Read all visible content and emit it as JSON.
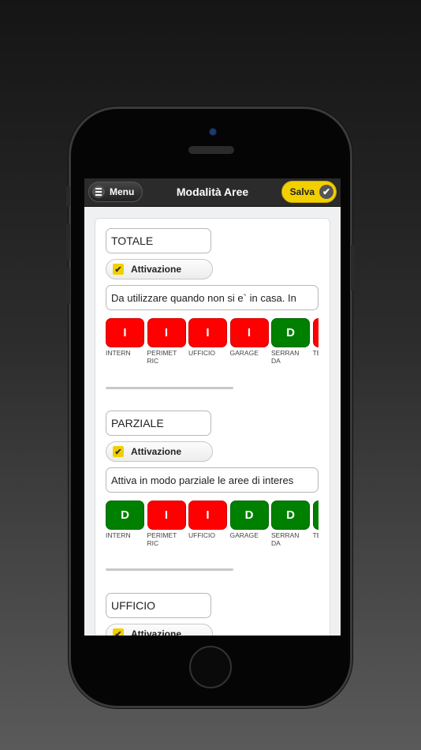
{
  "header": {
    "menu_label": "Menu",
    "title": "Modalità Aree",
    "save_label": "Salva"
  },
  "colors": {
    "on": "#ff0000",
    "off": "#008000",
    "accent": "#f2d000"
  },
  "modes": [
    {
      "name": "TOTALE",
      "activation_label": "Attivazione",
      "activation_checked": true,
      "description": "Da utilizzare quando non si e` in casa. In",
      "areas": [
        {
          "state": "I",
          "label": "INTERN"
        },
        {
          "state": "I",
          "label": "PERIMETRIC"
        },
        {
          "state": "I",
          "label": "UFFICIO"
        },
        {
          "state": "I",
          "label": "GARAGE"
        },
        {
          "state": "D",
          "label": "SERRANDA"
        },
        {
          "state": "I",
          "label": "TEIR"
        }
      ]
    },
    {
      "name": "PARZIALE",
      "activation_label": "Attivazione",
      "activation_checked": true,
      "description": "Attiva in modo parziale le aree di interes",
      "areas": [
        {
          "state": "D",
          "label": "INTERN"
        },
        {
          "state": "I",
          "label": "PERIMETRIC"
        },
        {
          "state": "I",
          "label": "UFFICIO"
        },
        {
          "state": "D",
          "label": "GARAGE"
        },
        {
          "state": "D",
          "label": "SERRANDA"
        },
        {
          "state": "D",
          "label": "TEIR"
        }
      ]
    },
    {
      "name": "UFFICIO",
      "activation_label": "Attivazione",
      "activation_checked": true
    }
  ]
}
